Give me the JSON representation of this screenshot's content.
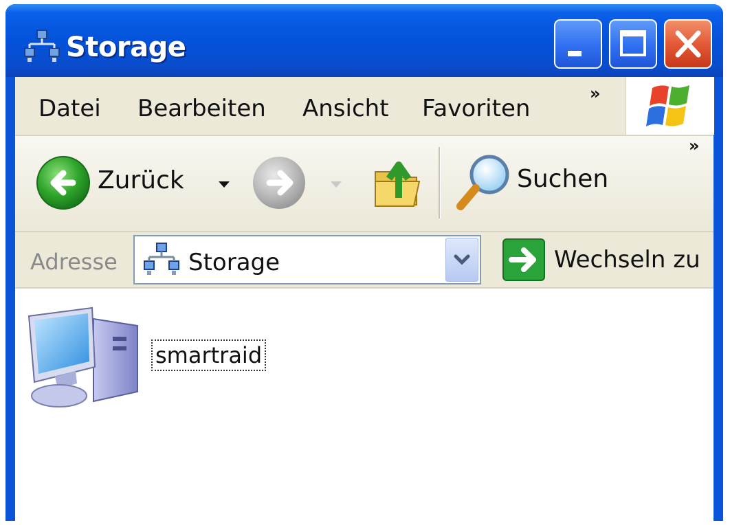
{
  "window": {
    "title": "Storage",
    "title_icon": "network-storage-icon",
    "controls": {
      "minimize_icon": "minimize-icon",
      "maximize_icon": "maximize-icon",
      "close_icon": "close-icon"
    }
  },
  "menubar": {
    "items": [
      "Datei",
      "Bearbeiten",
      "Ansicht",
      "Favoriten"
    ],
    "overflow": "»",
    "logo": "windows-logo-icon"
  },
  "toolbar": {
    "back_label": "Zurück",
    "search_label": "Suchen",
    "overflow": "»"
  },
  "addressbar": {
    "label": "Adresse",
    "value": "Storage",
    "go_label": "Wechseln zu"
  },
  "content": {
    "items": [
      {
        "label": "smartraid",
        "icon": "computer-icon",
        "selected": true
      }
    ]
  },
  "colors": {
    "titlebar": "#0452da",
    "menubar": "#ece9d8",
    "close_button": "#e35a36",
    "accent_green": "#2aa33a"
  }
}
